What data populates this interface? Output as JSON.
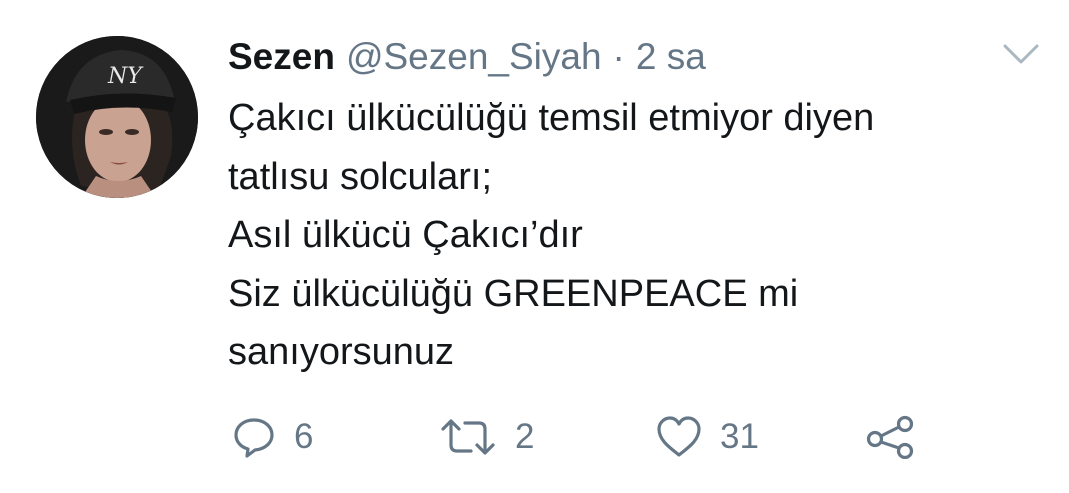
{
  "tweet": {
    "author": {
      "display_name": "Sezen",
      "handle": "@Sezen_Siyah",
      "avatar_icon": "profile-photo"
    },
    "separator": "·",
    "time": "2 sa",
    "body_lines": [
      "Çakıcı ülkücülüğü temsil etmiyor diyen",
      "tatlısu solcuları;",
      "Asıl ülkücü Çakıcı’dır",
      "Siz ülkücülüğü GREENPEACE mi",
      "sanıyorsunuz"
    ],
    "actions": {
      "reply": {
        "icon": "reply-icon",
        "count": "6"
      },
      "retweet": {
        "icon": "retweet-icon",
        "count": "2"
      },
      "like": {
        "icon": "heart-icon",
        "count": "31"
      },
      "share": {
        "icon": "share-icon"
      }
    },
    "menu_icon": "chevron-down-icon"
  },
  "colors": {
    "text_primary": "#14171a",
    "text_secondary": "#657786",
    "background": "#ffffff"
  }
}
